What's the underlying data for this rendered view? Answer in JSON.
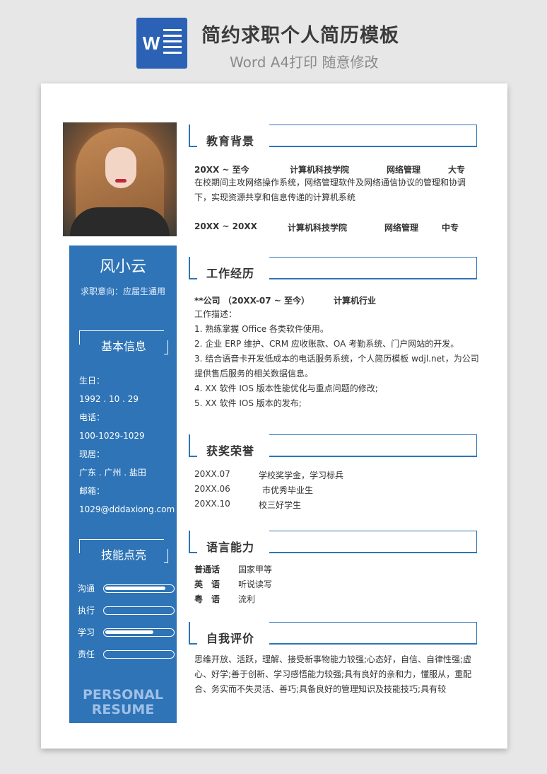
{
  "header": {
    "title": "简约求职个人简历模板",
    "subtitle": "Word A4打印 随意修改",
    "icon": "word-icon",
    "icon_letter": "W"
  },
  "profile": {
    "name": "风小云",
    "intent": "求职意向：应届生通用"
  },
  "basic": {
    "heading": "基本信息",
    "birth_label": "生日：",
    "birth": "1992 . 10 . 29",
    "phone_label": "电话：",
    "phone": "100-1029-1029",
    "address_label": "现居：",
    "address": "广东 . 广州 . 盐田",
    "email_label": "邮箱：",
    "email": "1029@dddaxiong.com"
  },
  "skills": {
    "heading": "技能点亮",
    "items": [
      {
        "label": "沟通",
        "level": 0.9
      },
      {
        "label": "执行",
        "level": 0.0
      },
      {
        "label": "学习",
        "level": 0.72
      },
      {
        "label": "责任",
        "level": 0.0
      }
    ]
  },
  "watermark": [
    "PERSONAL",
    "RESUME"
  ],
  "education": {
    "heading": "教育背景",
    "entries": [
      {
        "period": "20XX ~ 至今",
        "school": "计算机科技学院",
        "major": "网络管理",
        "degree": "大专",
        "desc": "在校期间主攻网络操作系统，网络管理软件及网络通信协议的管理和协调下，实现资源共享和信息传递的计算机系统"
      },
      {
        "period": "20XX ~ 20XX",
        "school": "计算机科技学院",
        "major": "网络管理",
        "degree": "中专"
      }
    ]
  },
  "work": {
    "heading": "工作经历",
    "company": "**公司 （20XX-07 ~ 至今）",
    "industry": "计算机行业",
    "desc_label": "工作描述：",
    "items": [
      "1. 熟练掌握 Office 各类软件使用。",
      "2. 企业 ERP 维护、CRM 应收账款、OA 考勤系统、门户网站的开发。",
      "3. 结合语音卡开发低成本的电话服务系统，个人简历模板 wdjl.net，为公司提供售后服务的相关数据信息。",
      "4. XX 软件 IOS 版本性能优化与重点问题的修改;",
      "5. XX 软件 IOS 版本的发布;"
    ]
  },
  "awards": {
    "heading": "获奖荣誉",
    "items": [
      {
        "date": "20XX.07",
        "name": "学校奖学金，学习标兵"
      },
      {
        "date": "20XX.06",
        "name": "市优秀毕业生"
      },
      {
        "date": "20XX.10",
        "name": "校三好学生"
      }
    ]
  },
  "language": {
    "heading": "语言能力",
    "items": [
      {
        "lang": "普通话",
        "level": "国家甲等"
      },
      {
        "lang": "英　语",
        "level": "听说读写"
      },
      {
        "lang": "粤　语",
        "level": "流利"
      }
    ]
  },
  "self": {
    "heading": "自我评价",
    "text": "思维开放、活跃，理解、接受新事物能力较强;心态好，自信、自律性强;虚心、好学;善于创新、学习感悟能力较强;具有良好的亲和力，懂服从，重配合、务实而不失灵活、善巧;具备良好的管理知识及技能技巧;具有较"
  }
}
